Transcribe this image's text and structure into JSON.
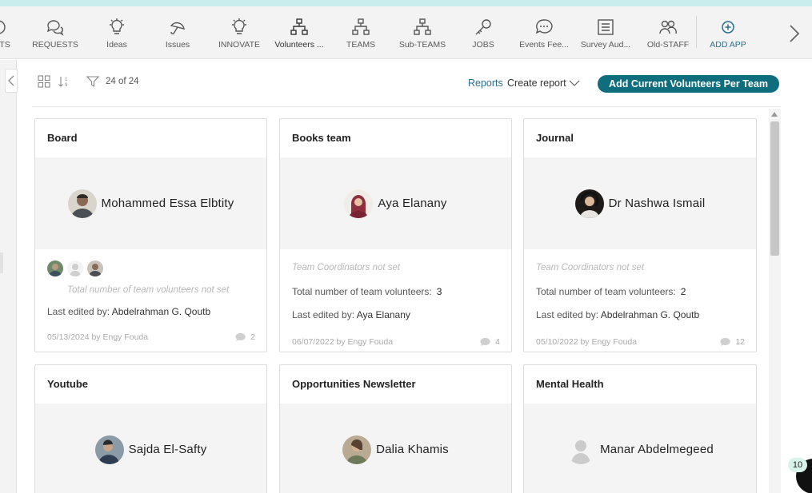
{
  "app_bar": {
    "items": [
      {
        "label": "TS",
        "icon": "partial-icon"
      },
      {
        "label": "REQUESTS",
        "icon": "chat-bubbles-icon"
      },
      {
        "label": "Ideas",
        "icon": "lightbulb-icon"
      },
      {
        "label": "Issues",
        "icon": "umbrella-icon"
      },
      {
        "label": "INNOVATE",
        "icon": "lightbulb-icon"
      },
      {
        "label": "Volunteers ...",
        "icon": "org-chart-icon",
        "active": true
      },
      {
        "label": "TEAMS",
        "icon": "org-chart-icon"
      },
      {
        "label": "Sub-TEAMS",
        "icon": "org-chart-icon"
      },
      {
        "label": "JOBS",
        "icon": "key-icon"
      },
      {
        "label": "Events Fee...",
        "icon": "speech-bubble-icon"
      },
      {
        "label": "Survey Aud...",
        "icon": "list-icon"
      },
      {
        "label": "Old-STAFF",
        "icon": "people-icon"
      },
      {
        "label": "ADD APP",
        "icon": "plus-circle-icon"
      }
    ]
  },
  "toolbar": {
    "count_label": "24 of 24",
    "reports_label": "Reports",
    "create_report_label": "Create report",
    "primary_button_label": "Add Current Volunteers Per Team"
  },
  "cards": [
    {
      "title": "Board",
      "member_name": "Mohammed Essa Elbtity",
      "volunteers_label": "Total number of team volunteers not set",
      "edited_prefix": "Last edited by:",
      "edited_by": "Abdelrahman G. Qoutb",
      "footer": "05/13/2024 by Engy Fouda",
      "comments": "2"
    },
    {
      "title": "Books team",
      "member_name": "Aya Elanany",
      "coordinators": "Team Coordinators not set",
      "volunteers_label": "Total number of team volunteers:",
      "volunteers_count": "3",
      "edited_prefix": "Last edited by:",
      "edited_by": "Aya Elanany",
      "footer": "06/07/2022 by Engy Fouda",
      "comments": "4"
    },
    {
      "title": "Journal",
      "member_name": "Dr Nashwa Ismail",
      "coordinators": "Team Coordinators not set",
      "volunteers_label": "Total number of team volunteers:",
      "volunteers_count": "2",
      "edited_prefix": "Last edited by:",
      "edited_by": "Abdelrahman G. Qoutb",
      "footer": "05/10/2022 by Engy Fouda",
      "comments": "12"
    },
    {
      "title": "Youtube",
      "member_name": "Sajda El-Safty"
    },
    {
      "title": "Opportunities Newsletter",
      "member_name": "Dalia Khamis"
    },
    {
      "title": "Mental Health",
      "member_name": "Manar Abdelmegeed"
    }
  ],
  "notifications": {
    "count": "10"
  },
  "colors": {
    "accent": "#0e6e7e",
    "link": "#2a6f8e",
    "top_strip": "#c9ecec"
  }
}
